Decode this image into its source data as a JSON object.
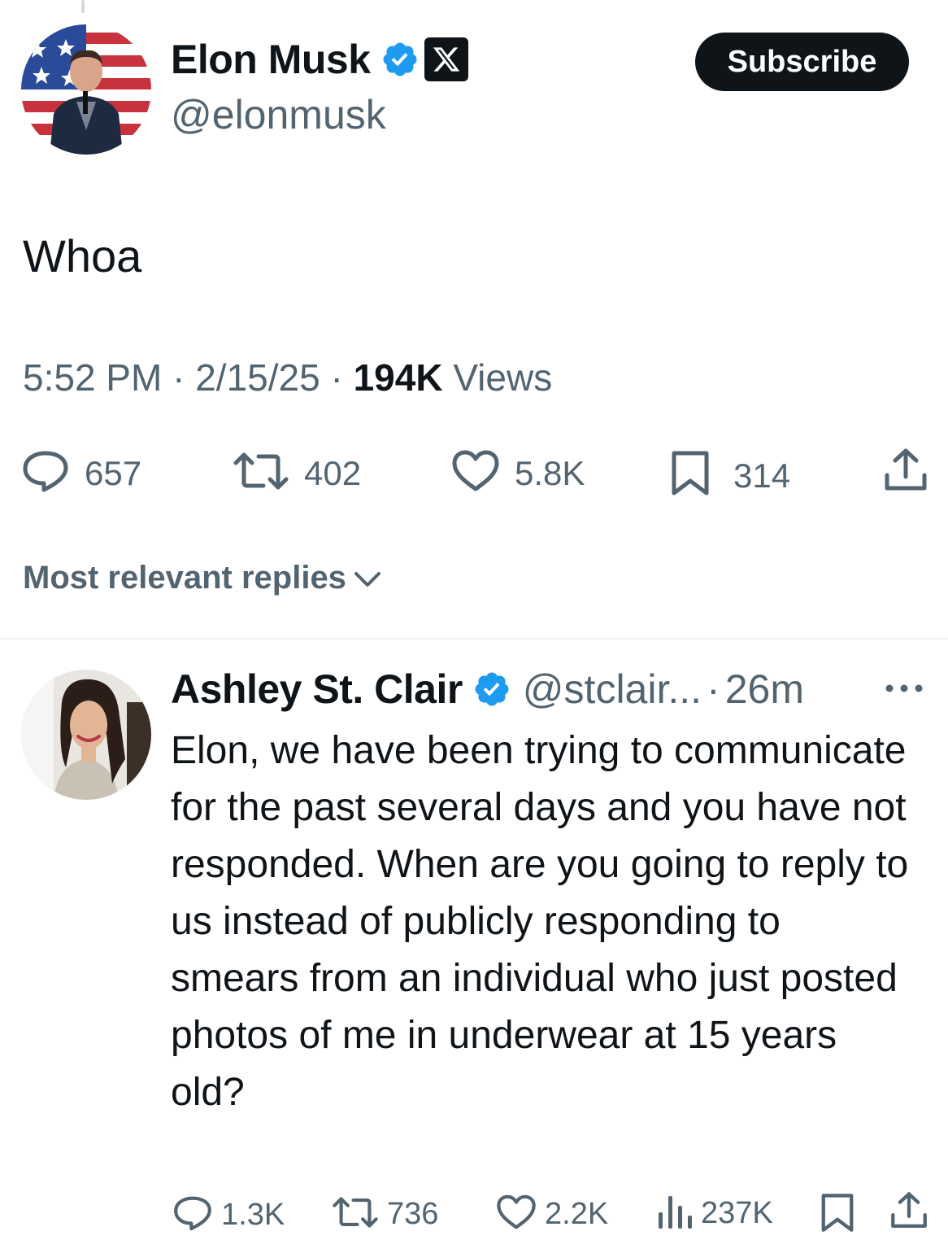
{
  "main_tweet": {
    "author_name": "Elon Musk",
    "handle": "@elonmusk",
    "subscribe_label": "Subscribe",
    "text": "Whoa",
    "time": "5:52 PM",
    "date": "2/15/25",
    "views_count": "194K",
    "views_label": "Views",
    "separator": "·",
    "actions": {
      "replies": "657",
      "reposts": "402",
      "likes": "5.8K",
      "bookmarks": "314"
    }
  },
  "replies_filter": {
    "label": "Most relevant replies"
  },
  "reply": {
    "author_name": "Ashley St. Clair",
    "handle": "@stclair...",
    "time": "26m",
    "separator": "·",
    "text": "Elon, we have been trying to communicate for the past several days and you have not responded. When are you going to reply to us instead of publicly responding to smears from an individual who just posted photos of me in underwear at 15 years old?",
    "actions": {
      "replies": "1.3K",
      "reposts": "736",
      "likes": "2.2K",
      "views": "237K"
    }
  },
  "colors": {
    "text": "#0f1419",
    "secondary": "#536471",
    "verified": "#1d9bf0",
    "button_bg": "#0f1419"
  },
  "icons": [
    "verified-badge-icon",
    "x-logo-icon",
    "reply-icon",
    "repost-icon",
    "like-icon",
    "bookmark-icon",
    "share-icon",
    "chevron-down-icon",
    "more-icon",
    "views-icon"
  ]
}
